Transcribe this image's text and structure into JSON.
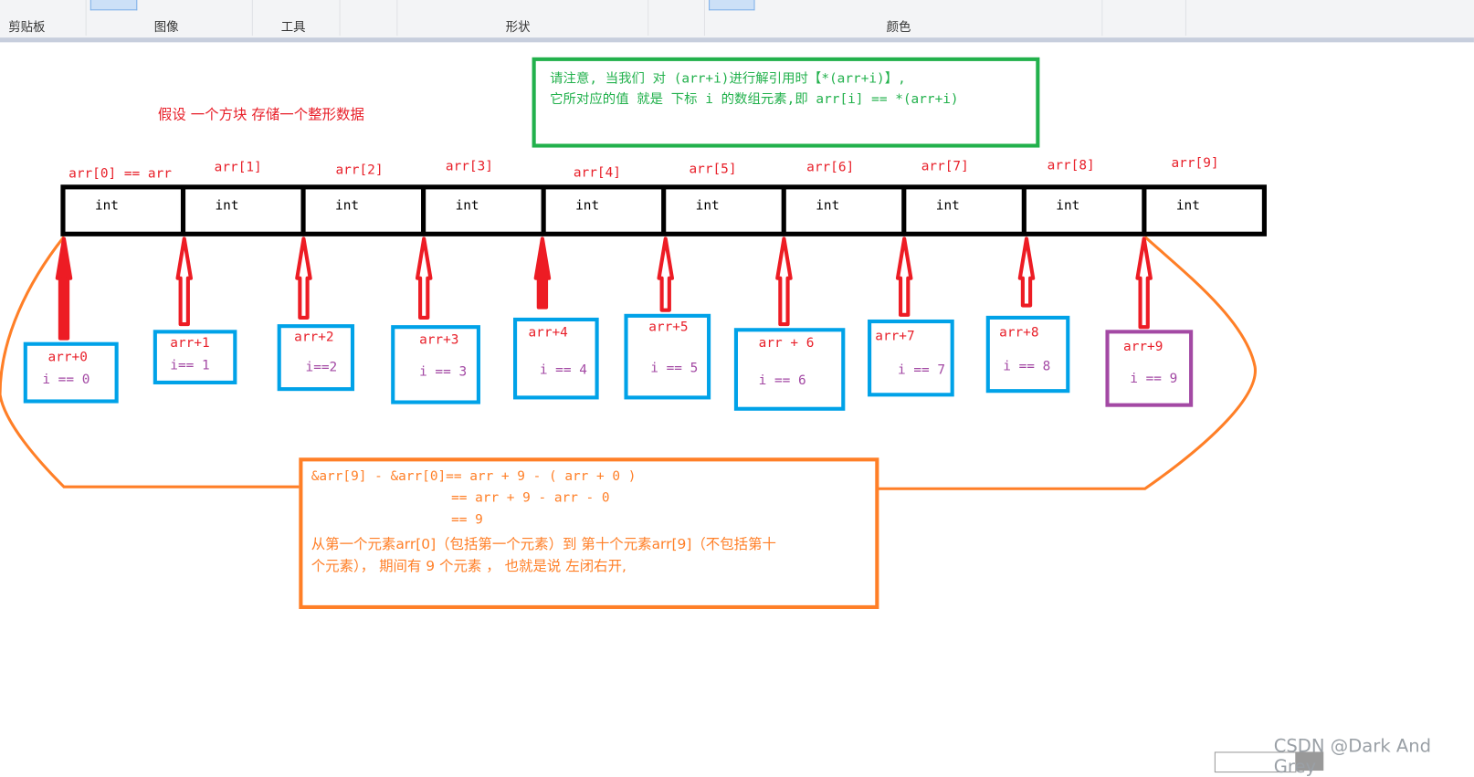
{
  "ribbon": {
    "groups": [
      "剪贴板",
      "图像",
      "工具",
      "形状",
      "颜色"
    ]
  },
  "note_red": "假设  一个方块 存储一个整形数据",
  "note_green": [
    "请注意, 当我们 对 (arr+i)进行解引用时【*(arr+i)】,",
    "它所对应的值 就是 下标 i 的数组元素,即 arr[i] == *(arr+i)"
  ],
  "array": {
    "labels": [
      "arr[0] == arr",
      "arr[1]",
      "arr[2]",
      "arr[3]",
      "arr[4]",
      "arr[5]",
      "arr[6]",
      "arr[7]",
      "arr[8]",
      "arr[9]"
    ],
    "cells": [
      "int",
      "int",
      "int",
      "int",
      "int",
      "int",
      "int",
      "int",
      "int",
      "int"
    ]
  },
  "pointers": [
    {
      "expr": "arr+0",
      "index": "i  == 0"
    },
    {
      "expr": "arr+1",
      "index": "i== 1"
    },
    {
      "expr": "arr+2",
      "index": "i==2"
    },
    {
      "expr": "arr+3",
      "index": "i  == 3"
    },
    {
      "expr": "arr+4",
      "index": "i  == 4"
    },
    {
      "expr": "arr+5",
      "index": "i  == 5"
    },
    {
      "expr": "arr + 6",
      "index": "i  == 6"
    },
    {
      "expr": "arr+7",
      "index": "i  == 7"
    },
    {
      "expr": "arr+8",
      "index": "i  == 8"
    },
    {
      "expr": "arr+9",
      "index": "i  == 9"
    }
  ],
  "explanation": [
    "&arr[9] - &arr[0]== arr + 9 - ( arr + 0 )",
    "== arr + 9 - arr - 0",
    "== 9",
    "从第一个元素arr[0]（包括第一个元素）到 第十个元素arr[9]（不包括第十",
    "个元素）， 期间有 9 个元素 ， 也就是说 左闭右开,"
  ],
  "watermark": "CSDN @Dark And Grey",
  "colors": {
    "red": "#e8202a",
    "green": "#22b14c",
    "blue": "#00a2e8",
    "purple": "#a349a4",
    "orange": "#ff7f27"
  }
}
